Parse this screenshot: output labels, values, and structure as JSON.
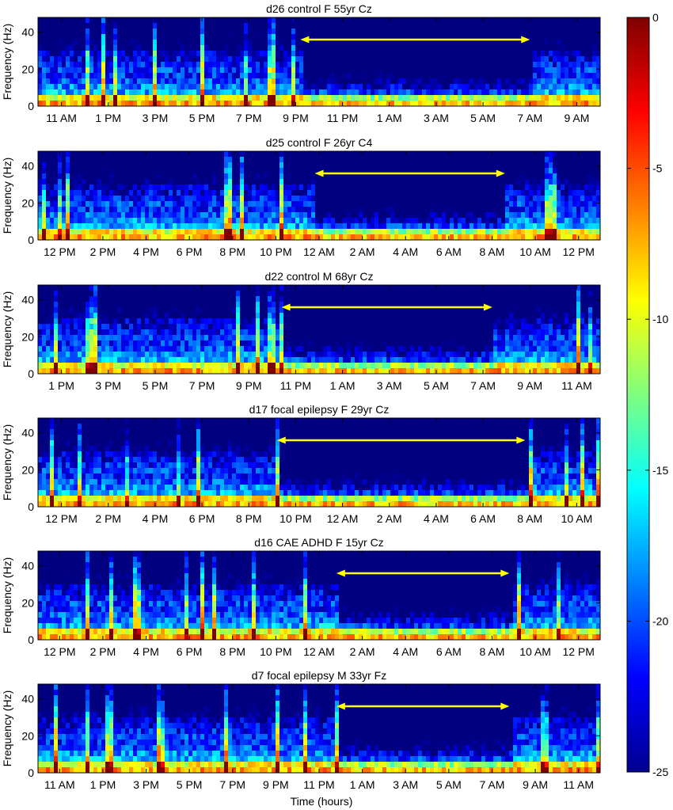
{
  "xlabel": "Time (hours)",
  "colorbar": {
    "ticks": [
      "0",
      "-5",
      "-10",
      "-15",
      "-20",
      "-25"
    ],
    "range": [
      -25,
      0
    ],
    "colormap": "jet"
  },
  "chart_data": [
    {
      "type": "heatmap",
      "title": "d26 control F 55yr Cz",
      "ylabel": "Frequency (Hz)",
      "yticks": [
        "0",
        "20",
        "40"
      ],
      "ylim": [
        0,
        48
      ],
      "xticks": [
        "11 AM",
        "1 PM",
        "3 PM",
        "5 PM",
        "7 PM",
        "9 PM",
        "11 PM",
        "1 AM",
        "3 AM",
        "5 AM",
        "7 AM",
        "9 AM"
      ],
      "sleep_interval_ticks": [
        5.6,
        10.5
      ]
    },
    {
      "type": "heatmap",
      "title": "d25 control F 26yr C4",
      "ylabel": "Frequency (Hz)",
      "yticks": [
        "0",
        "20",
        "40"
      ],
      "ylim": [
        0,
        48
      ],
      "xticks": [
        "12 PM",
        "2 PM",
        "4 PM",
        "6 PM",
        "8 PM",
        "10 PM",
        "12 AM",
        "2 AM",
        "4 AM",
        "6 AM",
        "8 AM",
        "10 AM",
        "12 PM"
      ],
      "sleep_interval_ticks": [
        6.4,
        10.8
      ]
    },
    {
      "type": "heatmap",
      "title": "d22 control M 68yr Cz",
      "ylabel": "Frequency (Hz)",
      "yticks": [
        "0",
        "20",
        "40"
      ],
      "ylim": [
        0,
        48
      ],
      "xticks": [
        "1 PM",
        "3 PM",
        "5 PM",
        "7 PM",
        "9 PM",
        "11 PM",
        "1 AM",
        "3 AM",
        "5 AM",
        "7 AM",
        "9 AM",
        "11 AM"
      ],
      "sleep_interval_ticks": [
        5.2,
        9.7
      ]
    },
    {
      "type": "heatmap",
      "title": "d17 focal epilepsy F 29yr Cz",
      "ylabel": "Frequency (Hz)",
      "yticks": [
        "0",
        "20",
        "40"
      ],
      "ylim": [
        0,
        48
      ],
      "xticks": [
        "12 PM",
        "2 PM",
        "4 PM",
        "6 PM",
        "8 PM",
        "10 PM",
        "12 AM",
        "2 AM",
        "4 AM",
        "6 AM",
        "8 AM",
        "10 AM"
      ],
      "sleep_interval_ticks": [
        5.1,
        10.4
      ]
    },
    {
      "type": "heatmap",
      "title": "d16  CAE ADHD F 15yr Cz",
      "ylabel": "Frequency (Hz)",
      "yticks": [
        "0",
        "20",
        "40"
      ],
      "ylim": [
        0,
        48
      ],
      "xticks": [
        "12 PM",
        "2 PM",
        "4 PM",
        "6 PM",
        "8 PM",
        "10 PM",
        "12 AM",
        "2 AM",
        "4 AM",
        "6 AM",
        "8 AM",
        "10 AM",
        "12 PM"
      ],
      "sleep_interval_ticks": [
        6.9,
        10.9
      ]
    },
    {
      "type": "heatmap",
      "title": "d7 focal epilepsy M 33yr Fz",
      "ylabel": "Frequency (Hz)",
      "yticks": [
        "0",
        "20",
        "40"
      ],
      "ylim": [
        0,
        48
      ],
      "xticks": [
        "11 AM",
        "1 PM",
        "3 PM",
        "5 PM",
        "7 PM",
        "9 PM",
        "11 PM",
        "1 AM",
        "3 AM",
        "5 AM",
        "7 AM",
        "9 AM",
        "11 AM"
      ],
      "sleep_interval_ticks": [
        6.9,
        10.9
      ]
    }
  ]
}
